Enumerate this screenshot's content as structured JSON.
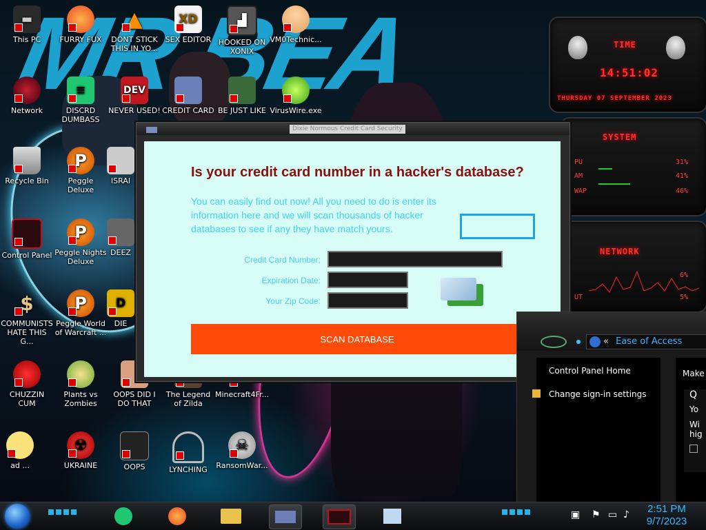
{
  "desktop": {
    "wallpaper_text": "MR BEA",
    "icons": [
      {
        "label": "This PC"
      },
      {
        "label": "FURRY FUX"
      },
      {
        "label": "DONT STICK THIS IN YO..."
      },
      {
        "label": "SEX EDITOR"
      },
      {
        "label": "HOOKED ON XONIX"
      },
      {
        "label": "VM0Technic..."
      },
      {
        "label": "Network"
      },
      {
        "label": "DISCRD DUMBASS"
      },
      {
        "label": "NEVER USED!"
      },
      {
        "label": "CREDIT CARD"
      },
      {
        "label": "BE JUST LIKE"
      },
      {
        "label": "VirusWire.exe"
      },
      {
        "label": "Recycle Bin"
      },
      {
        "label": "Peggle Deluxe"
      },
      {
        "label": "ISRAI"
      },
      {
        "label": "Control Panel"
      },
      {
        "label": "Peggle Nights Deluxe"
      },
      {
        "label": "DEEZ"
      },
      {
        "label": "COMMUNISTS HATE THIS G..."
      },
      {
        "label": "Peggle World of Warcraft ..."
      },
      {
        "label": "DIE"
      },
      {
        "label": "CHUZZIN CUM"
      },
      {
        "label": "Plants vs Zombies"
      },
      {
        "label": "OOPS DID I DO THAT"
      },
      {
        "label": "The Legend of Zilda"
      },
      {
        "label": "Minecraft4Fr..."
      },
      {
        "label": "ad ..."
      },
      {
        "label": "UKRAINE"
      },
      {
        "label": "OOPS"
      },
      {
        "label": "LYNCHING"
      },
      {
        "label": "RansomWar..."
      }
    ]
  },
  "gadgets": {
    "time_title": "TIME",
    "time_value": "14:51:02",
    "date_value": "THURSDAY 07 SEPTEMBER 2023",
    "system_title": "SYSTEM",
    "stats": [
      {
        "label": "PU",
        "value": "31%"
      },
      {
        "label": "AM",
        "value": "41%"
      },
      {
        "label": "WAP",
        "value": "46%"
      }
    ],
    "network_title": "NETWORK",
    "net_stats": [
      {
        "label": "",
        "value": "6%"
      },
      {
        "label": "UT",
        "value": "5%"
      }
    ]
  },
  "scam_window": {
    "title": "Dixie Normous Credit Card Security",
    "headline": "Is your credit card number in a hacker's database?",
    "intro": "You can easily find out now! All you need to do is enter its information here and we will scan thousands of hacker databases to see if any they have match yours.",
    "fields": [
      {
        "label": "Credit Card Number:",
        "value": ""
      },
      {
        "label": "Expiration Date:",
        "value": ""
      },
      {
        "label": "Your Zip Code:",
        "value": ""
      }
    ],
    "button": "SCAN DATABASE"
  },
  "control_panel": {
    "address": "Ease of Access",
    "sidebar": [
      "Control Panel Home",
      "Change sign-in settings"
    ],
    "main_heading": "Make y",
    "main_lines": [
      "Q",
      "Yo",
      "Wi",
      "hig"
    ]
  },
  "taskbar": {
    "time": "2:51 PM",
    "date": "9/7/2023"
  },
  "colors": {
    "scan_button": "#ff4b09",
    "headline": "#8a0f0f",
    "content_bg": "#d7fcf6",
    "intro_text": "#3ed3ef",
    "accent_blue": "#1aa3e6",
    "gadget_red": "#ff3030"
  }
}
